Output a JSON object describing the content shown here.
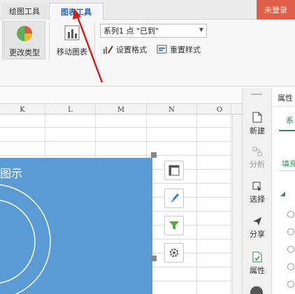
{
  "tabs": {
    "draw_tools": "绘图工具",
    "chart_tools": "图表工具",
    "login": "未登录"
  },
  "ribbon": {
    "change_type": "更改类型",
    "move_chart": "移动图表",
    "series_select": "系列1 点 \"已到\"",
    "set_format": "设置格式",
    "reset_style": "重置样式"
  },
  "sheet": {
    "columns": [
      "K",
      "L",
      "M",
      "N",
      "O"
    ],
    "chart_title_partial": "图示"
  },
  "right_strip": {
    "items": [
      "新建",
      "分析",
      "选择",
      "分享",
      "属性"
    ]
  },
  "properties_panel": {
    "title_partial": "属性",
    "tab_partial": "系",
    "fill_partial": "填充"
  },
  "colors": {
    "accent": "#2a6ac0",
    "chart_fill": "#5b9bd5",
    "login_bg": "#e2604a",
    "annotation": "#d0201a"
  }
}
